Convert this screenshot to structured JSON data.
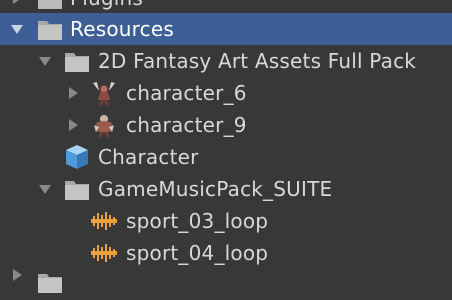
{
  "tree": {
    "items": [
      {
        "label": "Plugins",
        "icon": "folder-icon",
        "expanded": false
      },
      {
        "label": "Resources",
        "icon": "folder-icon",
        "expanded": true,
        "selected": true
      },
      {
        "label": "2D Fantasy Art Assets Full Pack",
        "icon": "folder-icon",
        "expanded": true
      },
      {
        "label": "character_6",
        "icon": "character-sprite-icon",
        "expanded": false
      },
      {
        "label": "character_9",
        "icon": "character-sprite-icon",
        "expanded": false
      },
      {
        "label": "Character",
        "icon": "prefab-cube-icon"
      },
      {
        "label": "GameMusicPack_SUITE",
        "icon": "folder-icon",
        "expanded": true
      },
      {
        "label": "sport_03_loop",
        "icon": "audio-clip-icon"
      },
      {
        "label": "sport_04_loop",
        "icon": "audio-clip-icon"
      }
    ]
  },
  "colors": {
    "background": "#383838",
    "selection": "#3e5f96",
    "audio_icon": "#e9a23b"
  }
}
